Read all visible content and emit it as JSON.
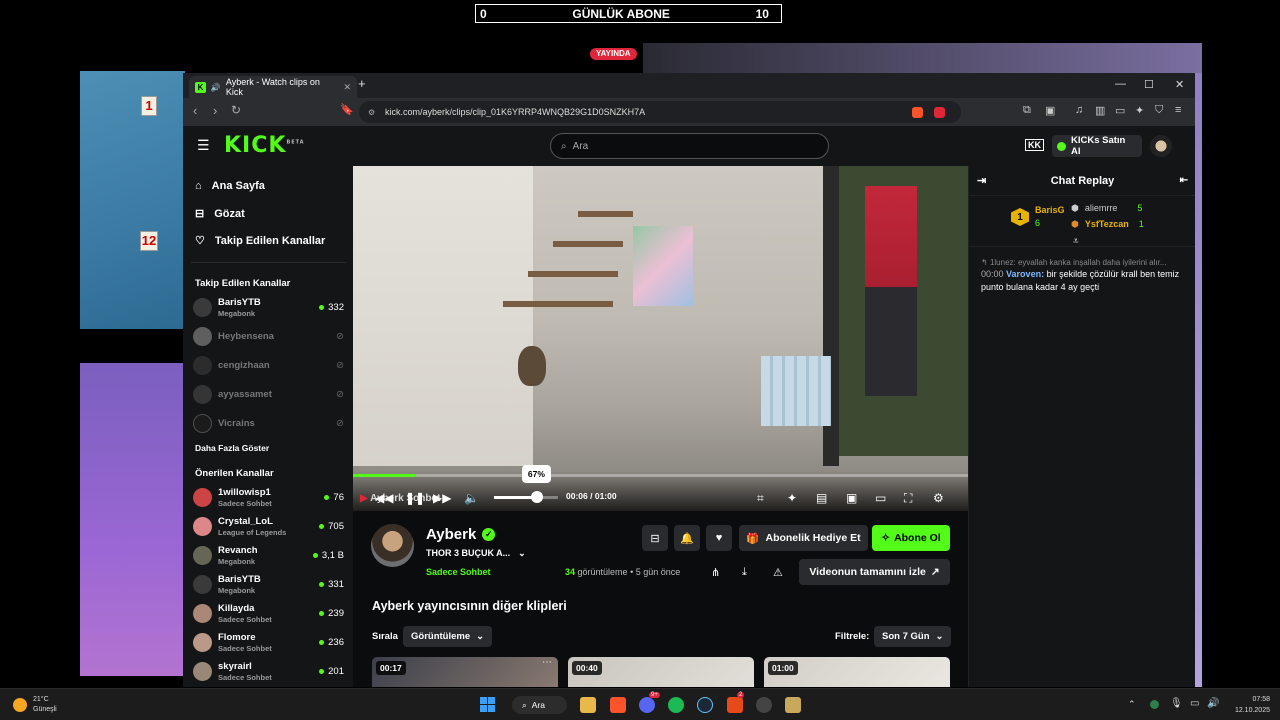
{
  "overlay": {
    "abone_left": "0",
    "abone_title": "GÜNLÜK ABONE",
    "abone_right": "10",
    "live_badge": "YAYINDA",
    "card_top": "1",
    "card_bottom": "12"
  },
  "browser": {
    "tab_title": "Ayberk - Watch clips on Kick",
    "new_tab": "+",
    "url": "kick.com/ayberk/clips/clip_01K6YRRP4WNQB29G1D0SNZKH7A",
    "window_min": "—",
    "window_max": "☐",
    "window_close": "✕"
  },
  "kick": {
    "logo": "KICK",
    "logo_beta": "BETA",
    "search_placeholder": "Ara",
    "buy_kicks": "KICKs Satın Al"
  },
  "sidebar": {
    "nav": [
      "Ana Sayfa",
      "Gözat",
      "Takip Edilen Kanallar"
    ],
    "followed_title": "Takip Edilen Kanallar",
    "followed": [
      {
        "name": "BarisYTB",
        "game": "Megabonk",
        "viewers": "332",
        "online": true
      },
      {
        "name": "Heybensena",
        "game": "",
        "viewers": "",
        "online": false
      },
      {
        "name": "cengizhaan",
        "game": "",
        "viewers": "",
        "online": false
      },
      {
        "name": "ayyassamet",
        "game": "",
        "viewers": "",
        "online": false
      },
      {
        "name": "Vicrains",
        "game": "",
        "viewers": "",
        "online": false
      }
    ],
    "show_more": "Daha Fazla Göster",
    "recommended_title": "Önerilen Kanallar",
    "recommended": [
      {
        "name": "1willowisp1",
        "game": "Sadece Sohbet",
        "viewers": "76"
      },
      {
        "name": "Crystal_LoL",
        "game": "League of Legends",
        "viewers": "705"
      },
      {
        "name": "Revanch",
        "game": "Megabonk",
        "viewers": "3,1 B"
      },
      {
        "name": "BarisYTB",
        "game": "Megabonk",
        "viewers": "331"
      },
      {
        "name": "Killayda",
        "game": "Sadece Sohbet",
        "viewers": "239"
      },
      {
        "name": "Flomore",
        "game": "Sadece Sohbet",
        "viewers": "236"
      },
      {
        "name": "skyrairl",
        "game": "Sadece Sohbet",
        "viewers": "201"
      }
    ]
  },
  "player": {
    "progress": 0.1,
    "volume": 0.67,
    "volume_label": "67%",
    "time_current": "00:06",
    "time_total": "01:00",
    "watermark": "Ayberk Sohbet"
  },
  "clip": {
    "channel": "Ayberk",
    "title": "THOR 3 BUÇUK A...",
    "category": "Sadece Sohbet",
    "views_count": "34",
    "views_word": "görüntüleme",
    "age": "• 5 gün önce",
    "gift_sub": "Abonelik Hediye Et",
    "subscribe": "Abone Ol",
    "watch_full": "Videonun tamamını izle",
    "other_clips": "Ayberk yayıncısının diğer klipleri",
    "sort_label": "Sırala",
    "sort_value": "Görüntüleme",
    "filter_label": "Filtrele:",
    "filter_value": "Son 7 Gün",
    "thumbs": [
      {
        "duration": "00:17"
      },
      {
        "duration": "00:40"
      },
      {
        "duration": "01:00"
      }
    ]
  },
  "chat": {
    "title": "Chat Replay",
    "leaders": [
      {
        "rank": "1",
        "name": "BarisG",
        "count": "6"
      },
      {
        "name": "aliemrre",
        "count": "5"
      },
      {
        "name": "YsfTezcan",
        "count": "1"
      }
    ],
    "reply_preview": "1lunez: eyvallah kanka inşallah daha iyilerini alır...",
    "msg_time": "00:00",
    "msg_user": "Varoven:",
    "msg_text": "bir şekilde çözülür krall ben temiz punto bulana kadar 4 ay geçti"
  },
  "taskbar": {
    "temp": "21°C",
    "weather": "Güneşli",
    "search": "Ara",
    "time": "07:58",
    "date": "12.10.2025",
    "notif_badge": "2",
    "discord_badge": "9+"
  }
}
